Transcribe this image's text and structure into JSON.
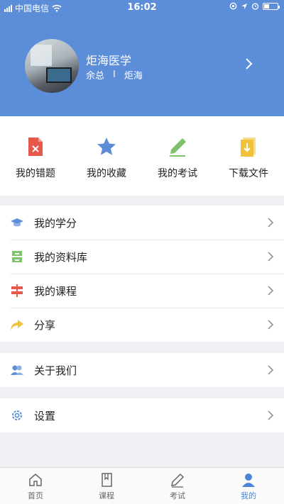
{
  "status_bar": {
    "carrier": "中国电信",
    "time": "16:02",
    "battery_level": 0.4
  },
  "profile": {
    "name": "炬海医学",
    "role": "余总",
    "separator": "I",
    "org": "炬海"
  },
  "quick_actions": [
    {
      "label": "我的错题",
      "icon": "wrong-questions-icon",
      "color": "#e5584a"
    },
    {
      "label": "我的收藏",
      "icon": "star-icon",
      "color": "#5b8dd9"
    },
    {
      "label": "我的考试",
      "icon": "pencil-icon",
      "color": "#7cc36b"
    },
    {
      "label": "下载文件",
      "icon": "download-file-icon",
      "color": "#f0c23c"
    }
  ],
  "menu_group_1": [
    {
      "label": "我的学分",
      "icon": "graduation-cap-icon"
    },
    {
      "label": "我的资料库",
      "icon": "archive-icon"
    },
    {
      "label": "我的课程",
      "icon": "signpost-icon"
    },
    {
      "label": "分享",
      "icon": "share-arrow-icon"
    }
  ],
  "menu_group_2": [
    {
      "label": "关于我们",
      "icon": "users-icon"
    }
  ],
  "menu_group_3": [
    {
      "label": "设置",
      "icon": "gear-icon"
    }
  ],
  "tabs": [
    {
      "label": "首页",
      "icon": "home-icon",
      "active": false
    },
    {
      "label": "课程",
      "icon": "book-icon",
      "active": false
    },
    {
      "label": "考试",
      "icon": "pen-icon",
      "active": false
    },
    {
      "label": "我的",
      "icon": "person-icon",
      "active": true
    }
  ]
}
